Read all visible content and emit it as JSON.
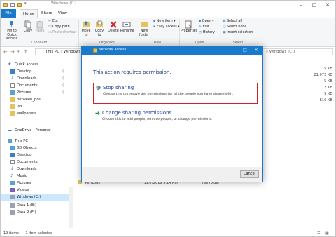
{
  "window": {
    "title": "Windows (C:)",
    "tabs": [
      "File",
      "Home",
      "Share",
      "View"
    ]
  },
  "ribbon": {
    "clipboard": {
      "pin_label": "Pin to Quick access",
      "copy_label": "Copy",
      "paste_label": "Paste",
      "cut_label": "Cut",
      "copy_path_label": "Copy path",
      "paste_shortcut_label": "Paste shortcut",
      "group_label": "Clipboard"
    },
    "organize": {
      "move_to_label": "Move to",
      "copy_to_label": "Copy to",
      "delete_label": "Delete",
      "rename_label": "Rename",
      "group_label": "Organize"
    },
    "new": {
      "new_folder_label": "New folder",
      "new_item_label": "New item",
      "easy_access_label": "Easy access",
      "group_label": "New"
    },
    "open": {
      "properties_label": "Properties",
      "open_label": "Open",
      "edit_label": "Edit",
      "history_label": "History",
      "group_label": "Open"
    },
    "select": {
      "select_all_label": "Select all",
      "select_none_label": "Select none",
      "invert_label": "Invert selection",
      "group_label": "Select"
    }
  },
  "address": {
    "path_this_pc": "This PC",
    "path_drive": "Windows (C:)",
    "search_text": "Windows (C:)"
  },
  "nav": {
    "quick_access": "Quick access",
    "items_quick": [
      "Desktop",
      "Downloads",
      "Documents",
      "Pictures",
      "between_pcs",
      "iso",
      "wallpapers"
    ],
    "onedrive": "OneDrive - Personal",
    "this_pc": "This PC",
    "items_pc": [
      "3D Objects",
      "Desktop",
      "Documents",
      "Downloads",
      "Music",
      "Pictures",
      "Videos",
      "Windows (C:)",
      "Data 1 (E:)",
      "Data 2 (F:)"
    ]
  },
  "sizes": [
    "5 KB",
    "21,072 KB",
    "5 KB",
    "2 KB",
    "5 KB",
    "816 KB"
  ],
  "background_row": {
    "name": "PerfLogs",
    "date": "12/7/2019 9:14 AM",
    "type": "File folder"
  },
  "status": {
    "item_count": "19 items",
    "selected": "1 item selected"
  },
  "dialog": {
    "title": "Network access",
    "heading": "This action requires permission.",
    "options": [
      {
        "title": "Stop sharing",
        "description": "Choose this to remove the permissions for all the people you have shared with."
      },
      {
        "title": "Change sharing permissions",
        "description": "Choose this to add people, remove people, or change permissions."
      }
    ],
    "cancel_label": "Cancel"
  },
  "colors": {
    "accent": "#1979ca",
    "highlight_border": "#d0202a",
    "link_title": "#1e3d9b"
  }
}
